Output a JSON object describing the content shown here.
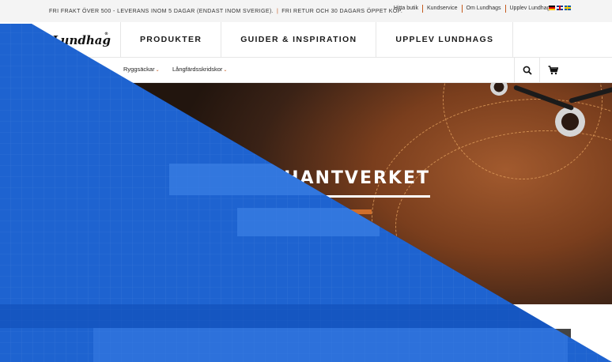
{
  "topbar": {
    "promo_left": "FRI FRAKT ÖVER 500 - LEVERANS INOM 5 DAGAR (ENDAST INOM SVERIGE).",
    "promo_right": "FRI RETUR OCH 30 DAGARS ÖPPET KÖP.",
    "links": [
      "Hitta butik",
      "Kundservice",
      "Om Lundhags",
      "Upplev Lundhags"
    ],
    "flags": [
      "de-flag-icon",
      "gb-flag-icon",
      "se-flag-icon"
    ]
  },
  "header": {
    "logo_text": "Lundhags",
    "nav": [
      "PRODUKTER",
      "GUIDER & INSPIRATION",
      "UPPLEV LUNDHAGS"
    ]
  },
  "subnav": {
    "items": [
      "Ryggsäckar",
      "Långfärdsskridskor"
    ],
    "icons": [
      "search-icon",
      "cart-icon"
    ]
  },
  "hero": {
    "title": "HANTVERKET"
  },
  "colors": {
    "accent": "#c55a1e",
    "overlay_blue": "#1e63d0",
    "hero_dark": "#2b1a12"
  }
}
